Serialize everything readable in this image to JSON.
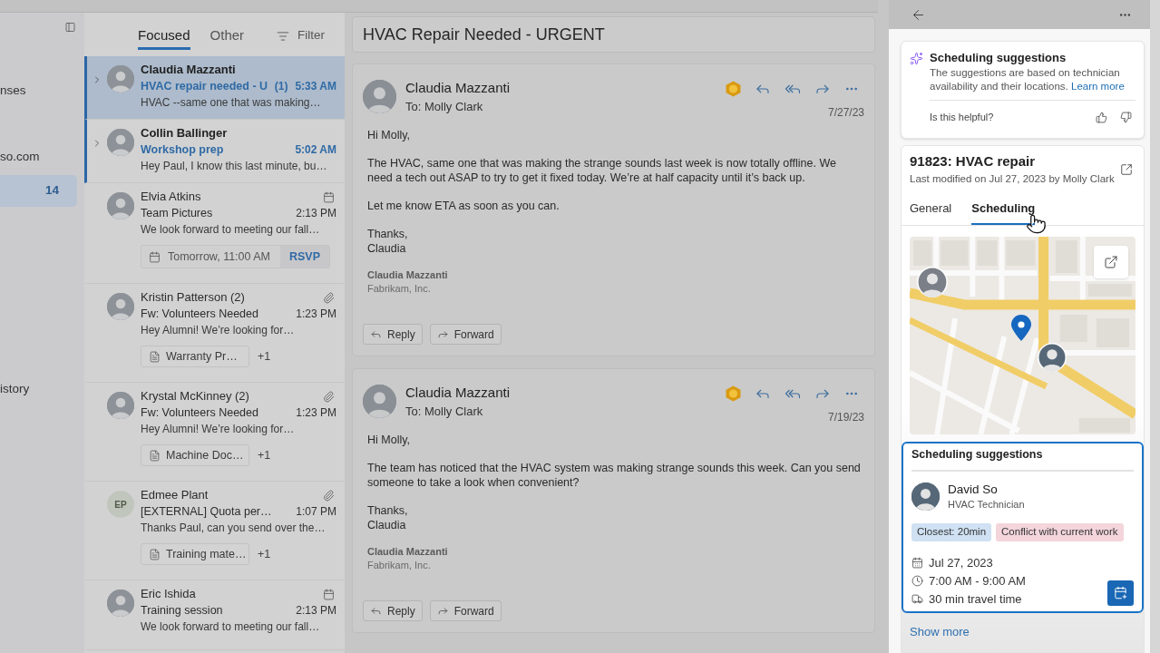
{
  "sidebar": {
    "items": [
      {
        "label": "nses",
        "selected": false
      },
      {
        "label": "so.com",
        "selected": false
      },
      {
        "count": "14",
        "selected": true
      },
      {
        "label": "istory",
        "selected": false
      }
    ]
  },
  "message_list": {
    "tabs": [
      {
        "label": "Focused",
        "selected": true
      },
      {
        "label": "Other",
        "selected": false
      }
    ],
    "filter": "Filter",
    "messages": [
      {
        "sender": "Claudia Mazzanti",
        "subject": "HVAC repair needed - U",
        "count": "(1)",
        "time": "5:33 AM",
        "preview": "HVAC --same one that was making…",
        "thread": true,
        "unread": true,
        "selected": true,
        "kind": "plain"
      },
      {
        "sender": "Collin Ballinger",
        "subject": "Workshop prep",
        "time": "5:02 AM",
        "preview": "Hey Paul, I know this last minute, bu…",
        "thread": true,
        "unread": true,
        "selected": false,
        "kind": "plain"
      },
      {
        "sender": "Elvia Atkins",
        "subject": "Team Pictures",
        "time": "2:13 PM",
        "preview": "We look forward to meeting our fall…",
        "thread": false,
        "unread": false,
        "selected": false,
        "kind": "event",
        "event": {
          "when": "Tomorrow, 11:00 AM",
          "action": "RSVP"
        }
      },
      {
        "sender": "Kristin Patterson (2)",
        "subject": "Fw: Volunteers Needed",
        "time": "1:23 PM",
        "preview": "Hey Alumni! We’re looking for…",
        "thread": false,
        "unread": false,
        "selected": false,
        "kind": "attachment",
        "attachment": {
          "name": "Warranty Pr…",
          "more": "+1"
        }
      },
      {
        "sender": "Krystal McKinney (2)",
        "subject": "Fw: Volunteers Needed",
        "time": "1:23 PM",
        "preview": "Hey Alumni! We’re looking for…",
        "thread": false,
        "unread": false,
        "selected": false,
        "kind": "attachment",
        "attachment": {
          "name": "Machine Doc…",
          "more": "+1"
        }
      },
      {
        "sender": "Edmee Plant",
        "initials": "EP",
        "subject": "[EXTERNAL] Quota per…",
        "time": "1:07 PM",
        "preview": "Thanks Paul, can you send over the…",
        "thread": false,
        "unread": false,
        "selected": false,
        "kind": "attachment",
        "attachment": {
          "name": "Training mate…",
          "more": "+1"
        }
      },
      {
        "sender": "Eric Ishida",
        "subject": "Training session",
        "time": "2:13 PM",
        "preview": "We look forward to meeting our fall…",
        "thread": false,
        "unread": false,
        "selected": false,
        "kind": "event"
      }
    ]
  },
  "reading_pane": {
    "title": "HVAC Repair Needed - URGENT",
    "emails": [
      {
        "sender": "Claudia Mazzanti",
        "to": "To: Molly Clark",
        "date": "7/27/23",
        "paragraphs": [
          [
            "Hi Molly,"
          ],
          [
            "The HVAC, same one that was making the strange sounds last week is now totally offline. We need a tech out ASAP to try to get it fixed today. We’re at half capacity until it’s back up."
          ],
          [
            "Let me know ETA as soon as you can."
          ],
          [
            "Thanks,",
            "Claudia"
          ]
        ],
        "signature": [
          "Claudia Mazzanti",
          "Fabrikam, Inc."
        ],
        "actions": [
          {
            "kind": "reply",
            "label": "Reply"
          },
          {
            "kind": "forward",
            "label": "Forward"
          }
        ]
      },
      {
        "sender": "Claudia Mazzanti",
        "to": "To: Molly Clark",
        "date": "7/19/23",
        "paragraphs": [
          [
            "Hi Molly,"
          ],
          [
            "The team has noticed that the HVAC system was making strange sounds this week. Can you send someone to take a look when convenient?"
          ],
          [
            "Thanks,",
            "Claudia"
          ]
        ],
        "signature": [
          "Claudia Mazzanti",
          "Fabrikam, Inc."
        ],
        "actions": [
          {
            "kind": "reply",
            "label": "Reply"
          },
          {
            "kind": "forward",
            "label": "Forward"
          }
        ]
      }
    ]
  },
  "details_pane": {
    "copilot_card": {
      "title": "Scheduling suggestions",
      "description": "The suggestions are based on technician availability and their locations.",
      "link": "Learn more",
      "feedback": "Is this helpful?"
    },
    "work_order": {
      "title": "91823: HVAC repair",
      "modified": "Last modified on Jul 27, 2023 by Molly Clark",
      "tabs": [
        {
          "label": "General",
          "selected": false
        },
        {
          "label": "Scheduling",
          "selected": true
        }
      ]
    },
    "suggestion": {
      "title": "Scheduling suggestions",
      "selected": true,
      "technician": {
        "name": "David So",
        "role": "HVAC Technician"
      },
      "tags": [
        {
          "label": "Closest: 20min",
          "color": "#cfe1f3"
        },
        {
          "label": "Conflict with current work",
          "color": "#f3d5db"
        }
      ],
      "details": [
        {
          "kind": "date",
          "text": "Jul 27, 2023"
        },
        {
          "kind": "time",
          "text": "7:00 AM - 9:00 AM"
        },
        {
          "kind": "travel",
          "text": "30 min travel time"
        }
      ]
    },
    "show_more": "Show more"
  }
}
